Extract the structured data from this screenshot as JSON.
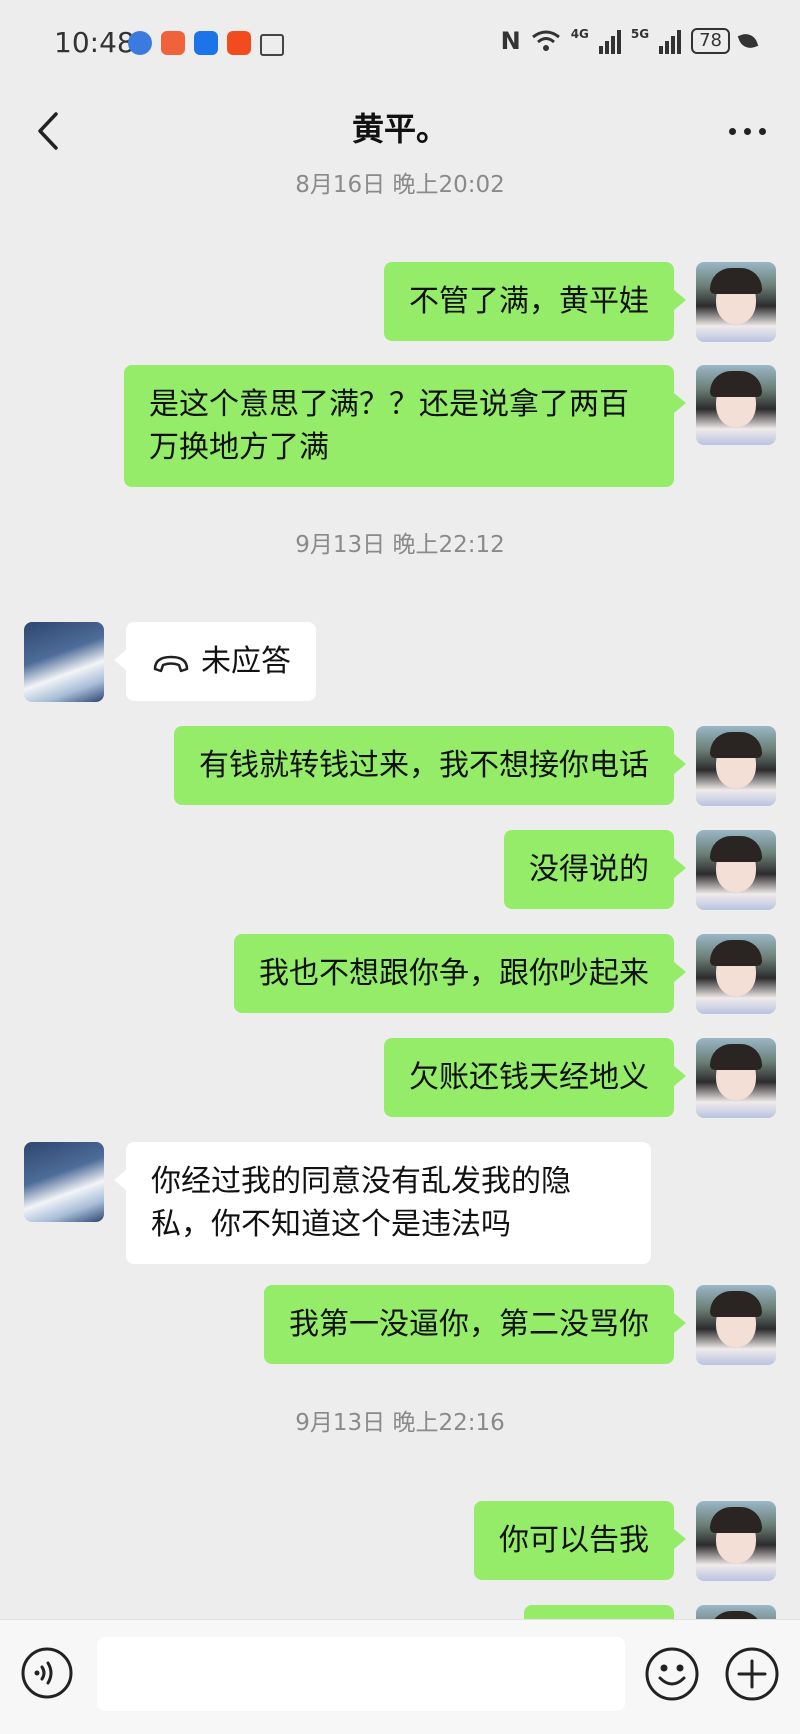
{
  "status_bar": {
    "time": "10:48",
    "nfc": "N",
    "net_a": "4G",
    "net_b": "5G",
    "battery": "78"
  },
  "nav": {
    "title": "黄平。"
  },
  "chat": {
    "timestamps": [
      "8月16日 晚上20:02",
      "9月13日 晚上22:12",
      "9月13日 晚上22:16"
    ],
    "messages": [
      {
        "side": "me",
        "text": "不管了满，黄平娃"
      },
      {
        "side": "me",
        "text": "是这个意思了满？？还是说拿了两百万换地方了满"
      },
      {
        "side": "them",
        "type": "call",
        "text": "未应答"
      },
      {
        "side": "me",
        "text": "有钱就转钱过来，我不想接你电话"
      },
      {
        "side": "me",
        "text": "没得说的"
      },
      {
        "side": "me",
        "text": "我也不想跟你争，跟你吵起来"
      },
      {
        "side": "me",
        "text": "欠账还钱天经地义"
      },
      {
        "side": "them",
        "text": "你经过我的同意没有乱发我的隐私，你不知道这个是违法吗"
      },
      {
        "side": "me",
        "text": "我第一没逼你，第二没骂你"
      },
      {
        "side": "me",
        "text": "你可以告我"
      }
    ]
  },
  "colors": {
    "background": "#ededed",
    "my_bubble": "#95ec69",
    "their_bubble": "#ffffff"
  },
  "icons": [
    "back-icon",
    "more-icon",
    "phone-icon",
    "voice-icon",
    "emoji-icon",
    "plus-icon"
  ]
}
